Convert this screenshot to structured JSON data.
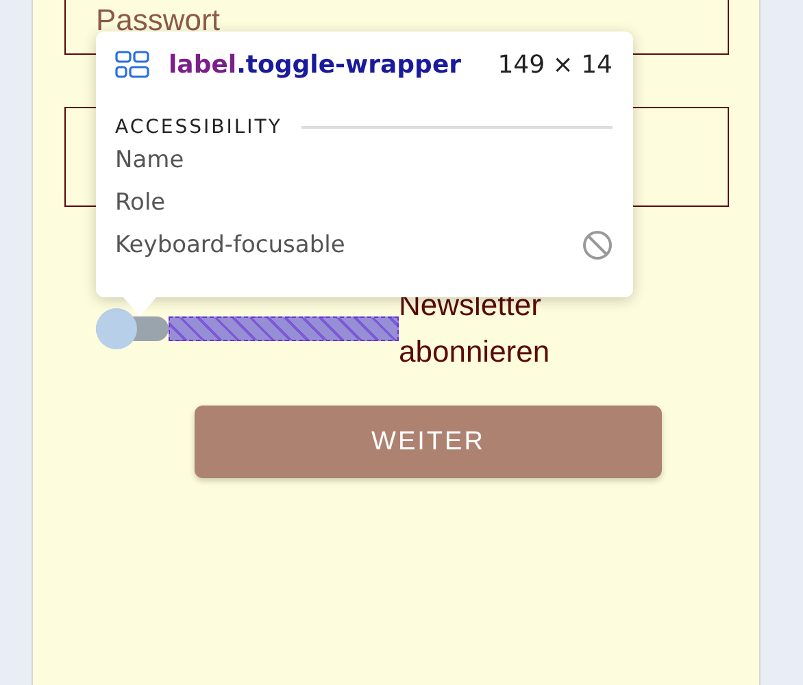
{
  "form": {
    "password_field": {
      "placeholder": "Passwort"
    },
    "newsletter": {
      "label": "Newsletter abonnieren",
      "checked": false
    },
    "submit_button": "WEITER"
  },
  "inspector_tooltip": {
    "tag": "label",
    "class_name": ".toggle-wrapper",
    "size": "149 × 14",
    "section": "ACCESSIBILITY",
    "rows": [
      {
        "label": "Name"
      },
      {
        "label": "Role"
      },
      {
        "label": "Keyboard-focusable",
        "kind": "blocked"
      }
    ]
  }
}
